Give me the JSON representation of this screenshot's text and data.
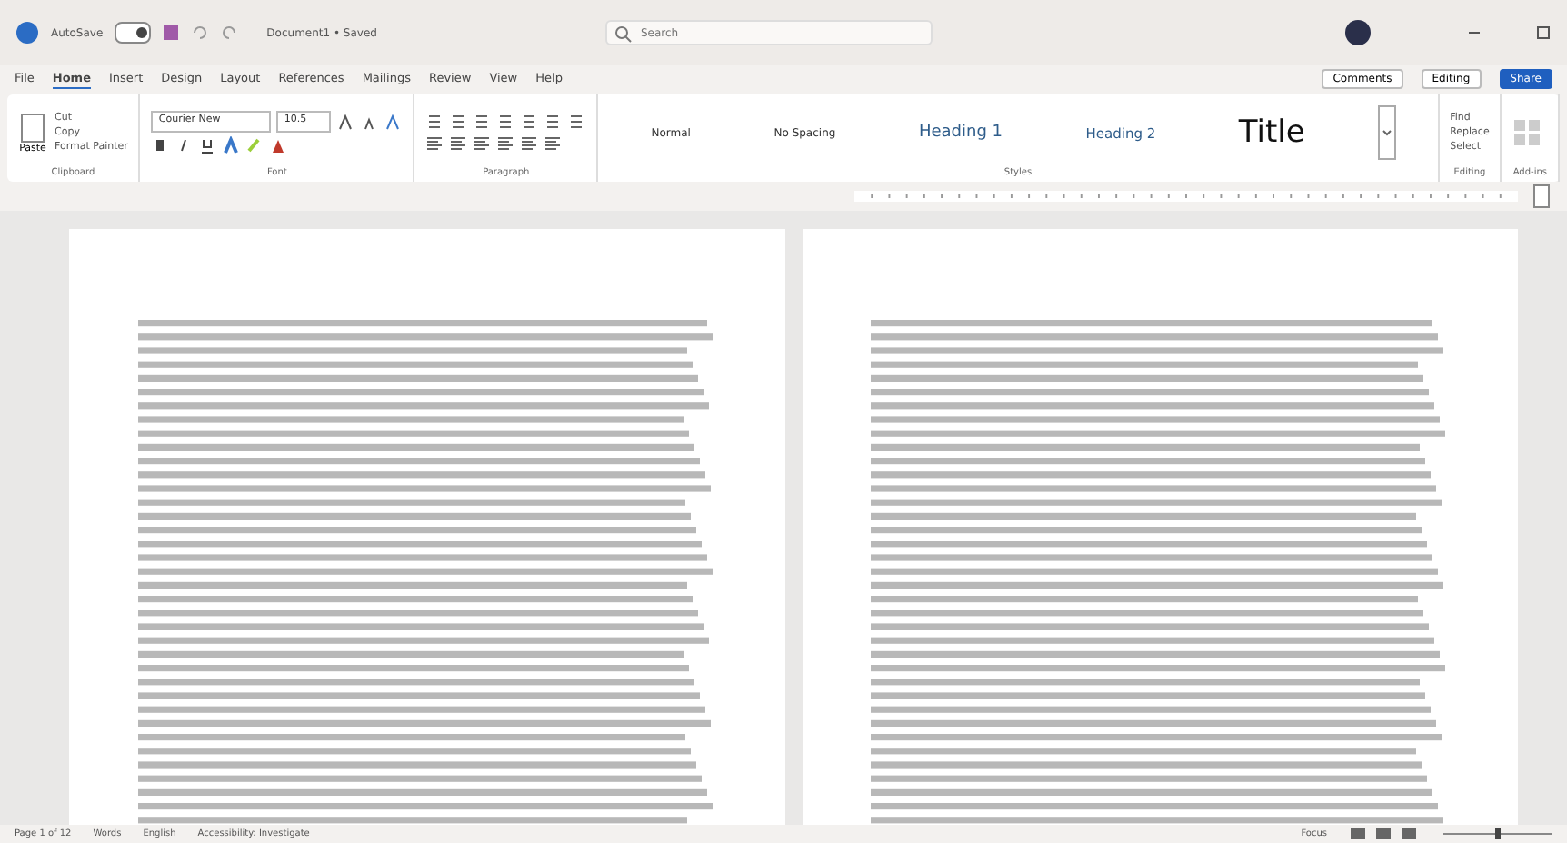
{
  "titlebar": {
    "autosave": "AutoSave",
    "autosave_on": true,
    "doc_title": "Document1 • Saved",
    "search": {
      "placeholder": "Search"
    }
  },
  "tabs": [
    {
      "label": "File",
      "selected": false
    },
    {
      "label": "Home",
      "selected": true
    },
    {
      "label": "Insert",
      "selected": false
    },
    {
      "label": "Design",
      "selected": false
    },
    {
      "label": "Layout",
      "selected": false
    },
    {
      "label": "References",
      "selected": false
    },
    {
      "label": "Mailings",
      "selected": false
    },
    {
      "label": "Review",
      "selected": false
    },
    {
      "label": "View",
      "selected": false
    },
    {
      "label": "Help",
      "selected": false
    }
  ],
  "actions": {
    "comments": "Comments",
    "editing": "Editing",
    "share": "Share"
  },
  "clipboard": {
    "paste": "Paste",
    "items": [
      "Cut",
      "Copy",
      "Format Painter"
    ],
    "label": "Clipboard"
  },
  "font": {
    "family": "Courier New",
    "size": "10.5",
    "label": "Font"
  },
  "paragraph": {
    "label": "Paragraph"
  },
  "styles": {
    "items": [
      {
        "label": "Normal",
        "kind": "normal"
      },
      {
        "label": "No Spacing",
        "kind": "normal"
      },
      {
        "label": "Heading 1",
        "kind": "heading1"
      },
      {
        "label": "Heading 2",
        "kind": "heading2"
      },
      {
        "label": "Title",
        "kind": "title"
      }
    ],
    "label": "Styles"
  },
  "editing": {
    "items": [
      "Find",
      "Replace",
      "Select"
    ],
    "label": "Editing"
  },
  "addins": {
    "label": "Add-ins"
  },
  "status_bar": {
    "left": [
      "Page 1 of 12",
      "Words",
      "English",
      "Accessibility: Investigate"
    ],
    "right": [
      "Focus"
    ],
    "zoom": {
      "level": 0.5
    }
  }
}
